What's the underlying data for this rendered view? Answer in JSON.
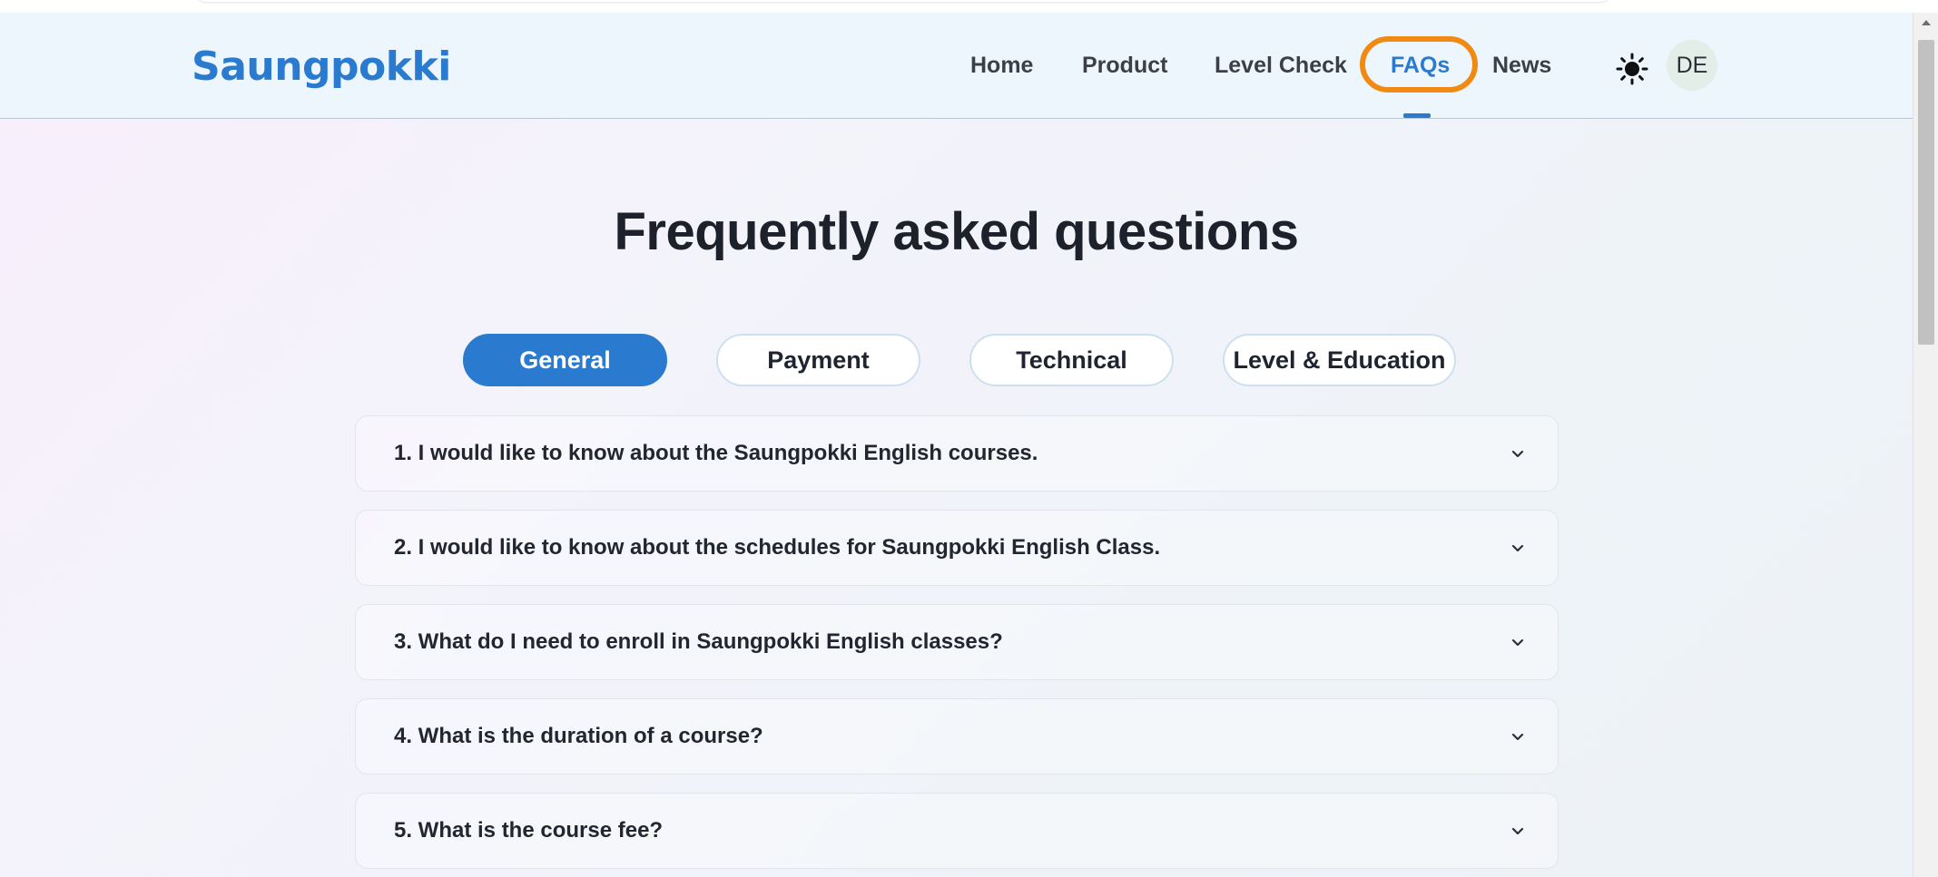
{
  "header": {
    "logo_text": "Saungpokki",
    "nav": [
      {
        "label": "Home"
      },
      {
        "label": "Product"
      },
      {
        "label": "Level Check"
      },
      {
        "label": "FAQs"
      },
      {
        "label": "News"
      }
    ],
    "active_nav": "FAQs",
    "language_label": "DE",
    "theme_icon": "sun-icon"
  },
  "main": {
    "title": "Frequently asked questions",
    "tabs": [
      {
        "label": "General"
      },
      {
        "label": "Payment"
      },
      {
        "label": "Technical"
      },
      {
        "label": "Level & Education"
      }
    ],
    "active_tab": "General",
    "faqs": [
      {
        "question": "1. I would like to know about the Saungpokki English courses."
      },
      {
        "question": "2. I would like to know about the schedules for Saungpokki English Class."
      },
      {
        "question": "3. What do I need to enroll in Saungpokki English classes?"
      },
      {
        "question": "4. What is the duration of a course?"
      },
      {
        "question": "5. What is the course fee?"
      }
    ]
  },
  "colors": {
    "brand": "#2a7bd0",
    "highlight_ring": "#f08a12"
  }
}
